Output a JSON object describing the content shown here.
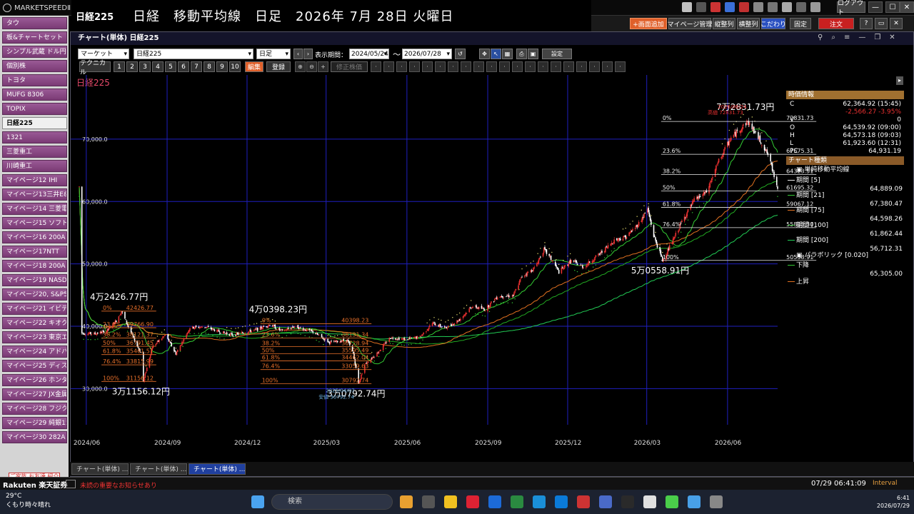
{
  "app": {
    "logo": "MARKETSPEEDⅡ",
    "symbol": "日経225",
    "headline": "日経　移動平均線　日足　2026年 7月 28日 火曜日",
    "logout": "ログアウト",
    "help": "?",
    "minimize": "—",
    "close": "✕"
  },
  "toolbar_buttons": [
    "+画面追加",
    "マイページ管理",
    "縦整列",
    "横整列",
    "こだわり",
    "固定",
    "注文"
  ],
  "sidebar": {
    "items": [
      "タウ",
      "板&チャートセット",
      "シンプル武蔵 ドル円Bid",
      "個別株",
      "トヨタ",
      "MUFG 8306",
      "TOPIX",
      "日経225",
      "1321",
      "三菱重工",
      "川崎重工",
      "マイページ12 IHI",
      "マイページ13三井E&S",
      "マイページ14 三菱電機",
      "マイページ15 ソフトバンク",
      "マイページ16 200A",
      "マイページ17NTT",
      "マイページ18 200A",
      "マイページ19 NASDAQ",
      "マイページ20, S&P500",
      "マイページ21 イビデン",
      "マイページ22 キオクシア",
      "マイページ23 東京エレクトロン",
      "マイページ24 アドバンテスト",
      "マイページ25 ディスコ",
      "マイページ26 ホンダ",
      "マイページ27 JX金属",
      "マイページ28 フジクラ",
      "マイページ29 純銀1542",
      "マイページ30 282A"
    ],
    "active_index": 7,
    "promo": "ご家族 お友達 紹介プログラム"
  },
  "chart_window": {
    "title": "チャート(単体) 日経225",
    "market_select": "マーケット",
    "symbol_select": "日経225",
    "period_select": "日足",
    "display_period_label": "表示期間：",
    "date_from": "2024/05/24",
    "tilde": "～",
    "date_to": "2026/07/28",
    "settings_label": "設定",
    "technical_label": "テクニカル",
    "number_buttons": [
      "1",
      "2",
      "3",
      "4",
      "5",
      "6",
      "7",
      "8",
      "9",
      "10"
    ],
    "edit_label": "編集",
    "register_label": "登録",
    "adjusted_label": "修正株価"
  },
  "info_panel": {
    "header": "時価情報",
    "rows": [
      {
        "k": "C",
        "v": "62,364.92 (15:45)"
      },
      {
        "k": "",
        "v": "-2,566.27  -3.95%"
      },
      {
        "k": "V",
        "v": "0"
      },
      {
        "k": "O",
        "v": "64,539.92 (09:00)"
      },
      {
        "k": "H",
        "v": "64,573.18 (09:03)"
      },
      {
        "k": "L",
        "v": "61,923.60 (12:31)"
      },
      {
        "k": "PC",
        "v": "64,931.19"
      }
    ],
    "chart_type_header": "チャート種類",
    "sma_label": "単純移動平均線",
    "mas": [
      {
        "label": "期間 [5]",
        "value": "64,889.09",
        "color": "#e8e8e8"
      },
      {
        "label": "期間 [21]",
        "value": "67,380.47",
        "color": "#33cc33"
      },
      {
        "label": "期間 [75]",
        "value": "64,598.26",
        "color": "#e07020"
      },
      {
        "label": "期間 [100]",
        "value": "61,862.44",
        "color": "#22aa22"
      },
      {
        "label": "期間 [200]",
        "value": "56,712.31",
        "color": "#22cc55"
      }
    ],
    "parabolic_label": "パラボリック [0.020]",
    "down_label": "下降",
    "down_value": "65,305.00",
    "up_label": "上昇"
  },
  "chart_data": {
    "type": "line",
    "title": "日経225",
    "x_ticks": [
      "2024/06",
      "2024/09",
      "2024/12",
      "2025/03",
      "2025/06",
      "2025/09",
      "2025/12",
      "2026/03",
      "2026/06"
    ],
    "y_ticks": [
      "30,000.0",
      "40,000.0",
      "50,000.0",
      "60,000.0",
      "70,000.0"
    ],
    "ylim": [
      26500,
      78000
    ],
    "grid": true,
    "series": [
      {
        "name": "日経225",
        "points": [
          [
            "2024-05-27",
            38900
          ],
          [
            "2024-06-10",
            38800
          ],
          [
            "2024-06-24",
            39200
          ],
          [
            "2024-07-05",
            40900
          ],
          [
            "2024-07-11",
            42426.77
          ],
          [
            "2024-07-25",
            38000
          ],
          [
            "2024-08-02",
            35800
          ],
          [
            "2024-08-05",
            31156.12
          ],
          [
            "2024-08-15",
            36700
          ],
          [
            "2024-08-30",
            38600
          ],
          [
            "2024-09-11",
            35600
          ],
          [
            "2024-09-27",
            39800
          ],
          [
            "2024-10-15",
            39900
          ],
          [
            "2024-10-31",
            39100
          ],
          [
            "2024-11-15",
            38600
          ],
          [
            "2024-12-13",
            39500
          ],
          [
            "2024-12-27",
            40300
          ],
          [
            "2025-01-10",
            39200
          ],
          [
            "2025-01-24",
            40000
          ],
          [
            "2025-02-14",
            39100
          ],
          [
            "2025-03-05",
            37400
          ],
          [
            "2025-03-25",
            37800
          ],
          [
            "2025-04-01",
            35600
          ],
          [
            "2025-04-07",
            30792.74
          ],
          [
            "2025-04-14",
            33900
          ],
          [
            "2025-04-28",
            35700
          ],
          [
            "2025-05-13",
            38200
          ],
          [
            "2025-05-30",
            37900
          ],
          [
            "2025-06-16",
            38300
          ],
          [
            "2025-06-30",
            40500
          ],
          [
            "2025-07-15",
            39700
          ],
          [
            "2025-07-31",
            41100
          ],
          [
            "2025-08-14",
            43200
          ],
          [
            "2025-08-29",
            42700
          ],
          [
            "2025-09-12",
            44800
          ],
          [
            "2025-09-30",
            44900
          ],
          [
            "2025-10-10",
            48000
          ],
          [
            "2025-10-24",
            49300
          ],
          [
            "2025-11-04",
            52300
          ],
          [
            "2025-11-14",
            50400
          ],
          [
            "2025-11-21",
            48700
          ],
          [
            "2025-12-05",
            50500
          ],
          [
            "2025-12-19",
            49500
          ],
          [
            "2026-01-09",
            51900
          ],
          [
            "2026-01-23",
            53800
          ],
          [
            "2026-02-06",
            54400
          ],
          [
            "2026-02-20",
            56500
          ],
          [
            "2026-03-02",
            58800
          ],
          [
            "2026-03-09",
            54500
          ],
          [
            "2026-03-19",
            50558.91
          ],
          [
            "2026-03-30",
            53500
          ],
          [
            "2026-04-10",
            56800
          ],
          [
            "2026-04-24",
            60200
          ],
          [
            "2026-05-08",
            61500
          ],
          [
            "2026-05-22",
            66500
          ],
          [
            "2026-06-05",
            70200
          ],
          [
            "2026-06-24",
            72831.73
          ],
          [
            "2026-07-08",
            69800
          ],
          [
            "2026-07-17",
            67500
          ],
          [
            "2026-07-28",
            62364.92
          ]
        ]
      }
    ],
    "annotations": [
      {
        "text": "4万2426.77円",
        "x": "2024-07-11",
        "y": 42426.77,
        "pos": "above"
      },
      {
        "text": "3万1156.12円",
        "x": "2024-08-05",
        "y": 31156.12,
        "pos": "below"
      },
      {
        "text": "4万0398.23円",
        "x": "2025-01-08",
        "y": 40398.23,
        "pos": "above"
      },
      {
        "text": "3万0792.74円",
        "x": "2025-04-07",
        "y": 30792.74,
        "pos": "below"
      },
      {
        "text": "7万2831.73円",
        "x": "2026-06-24",
        "y": 72831.73,
        "pos": "above"
      },
      {
        "text": "5万0558.91円",
        "x": "2026-03-19",
        "y": 50558.91,
        "pos": "below"
      }
    ],
    "fib_sets": [
      {
        "from": "2024-07-11",
        "to": "2024-08-05",
        "color": "#e8702a",
        "levels": [
          [
            "0%",
            42426.77,
            "42426.77"
          ],
          [
            "23.6%",
            39766.9,
            "39766.90"
          ],
          [
            "38.2%",
            38121.37,
            "38121.37"
          ],
          [
            "50%",
            36791.45,
            "36791.45"
          ],
          [
            "61.8%",
            35461.51,
            "35461.51"
          ],
          [
            "76.4%",
            33815.99,
            "33815.99"
          ],
          [
            "100%",
            31156.12,
            "31156.12"
          ]
        ]
      },
      {
        "from": "2025-01-08",
        "to": "2025-04-07",
        "color": "#e8702a",
        "levels": [
          [
            "0%",
            40398.23,
            "40398.23"
          ],
          [
            "23.6%",
            38131.34,
            "38131.34"
          ],
          [
            "38.2%",
            36728.94,
            "36728.94"
          ],
          [
            "50%",
            35595.49,
            "35595.49"
          ],
          [
            "61.8%",
            34462.04,
            "34462.04"
          ],
          [
            "76.4%",
            33059.63,
            "33059.63"
          ],
          [
            "100%",
            30792.74,
            "30792.74"
          ]
        ]
      },
      {
        "from": "2026-03-19",
        "to": "2026-06-24",
        "color": "#f0f0f0",
        "levels": [
          [
            "0%",
            72831.73,
            "72831.73"
          ],
          [
            "23.6%",
            67575.31,
            "67575.31"
          ],
          [
            "38.2%",
            64323.51,
            "64323.51"
          ],
          [
            "50%",
            61695.32,
            "61695.32"
          ],
          [
            "61.8%",
            59067.12,
            "59067.12"
          ],
          [
            "76.4%",
            55815.3,
            "55815.30"
          ],
          [
            "100%",
            50558.91,
            "50558.91"
          ]
        ]
      }
    ],
    "low_note": [
      "2025/04/07",
      "安値 30792.74"
    ],
    "high_note": [
      "2026/06/24",
      "高値 72831.73"
    ]
  },
  "tabs": [
    "チャート(単体) ...",
    "チャート(単体) ...",
    "チャート(単体) ..."
  ],
  "status": {
    "brand": "Rakuten 楽天証券",
    "alert": "未読の重要なお知らせあり",
    "datetime": "07/29 06:41:09",
    "interval": "Interval"
  },
  "taskbar": {
    "temp": "29°C",
    "weather": "くもり時々晴れ",
    "search_placeholder": "検索",
    "time": "6:41",
    "date": "2026/07/29"
  },
  "colors": {
    "up": "#e83030",
    "down": "#ffffff",
    "grid": "#1f1fbf",
    "fib_orange": "#e8702a",
    "accent": "#e0602a"
  }
}
